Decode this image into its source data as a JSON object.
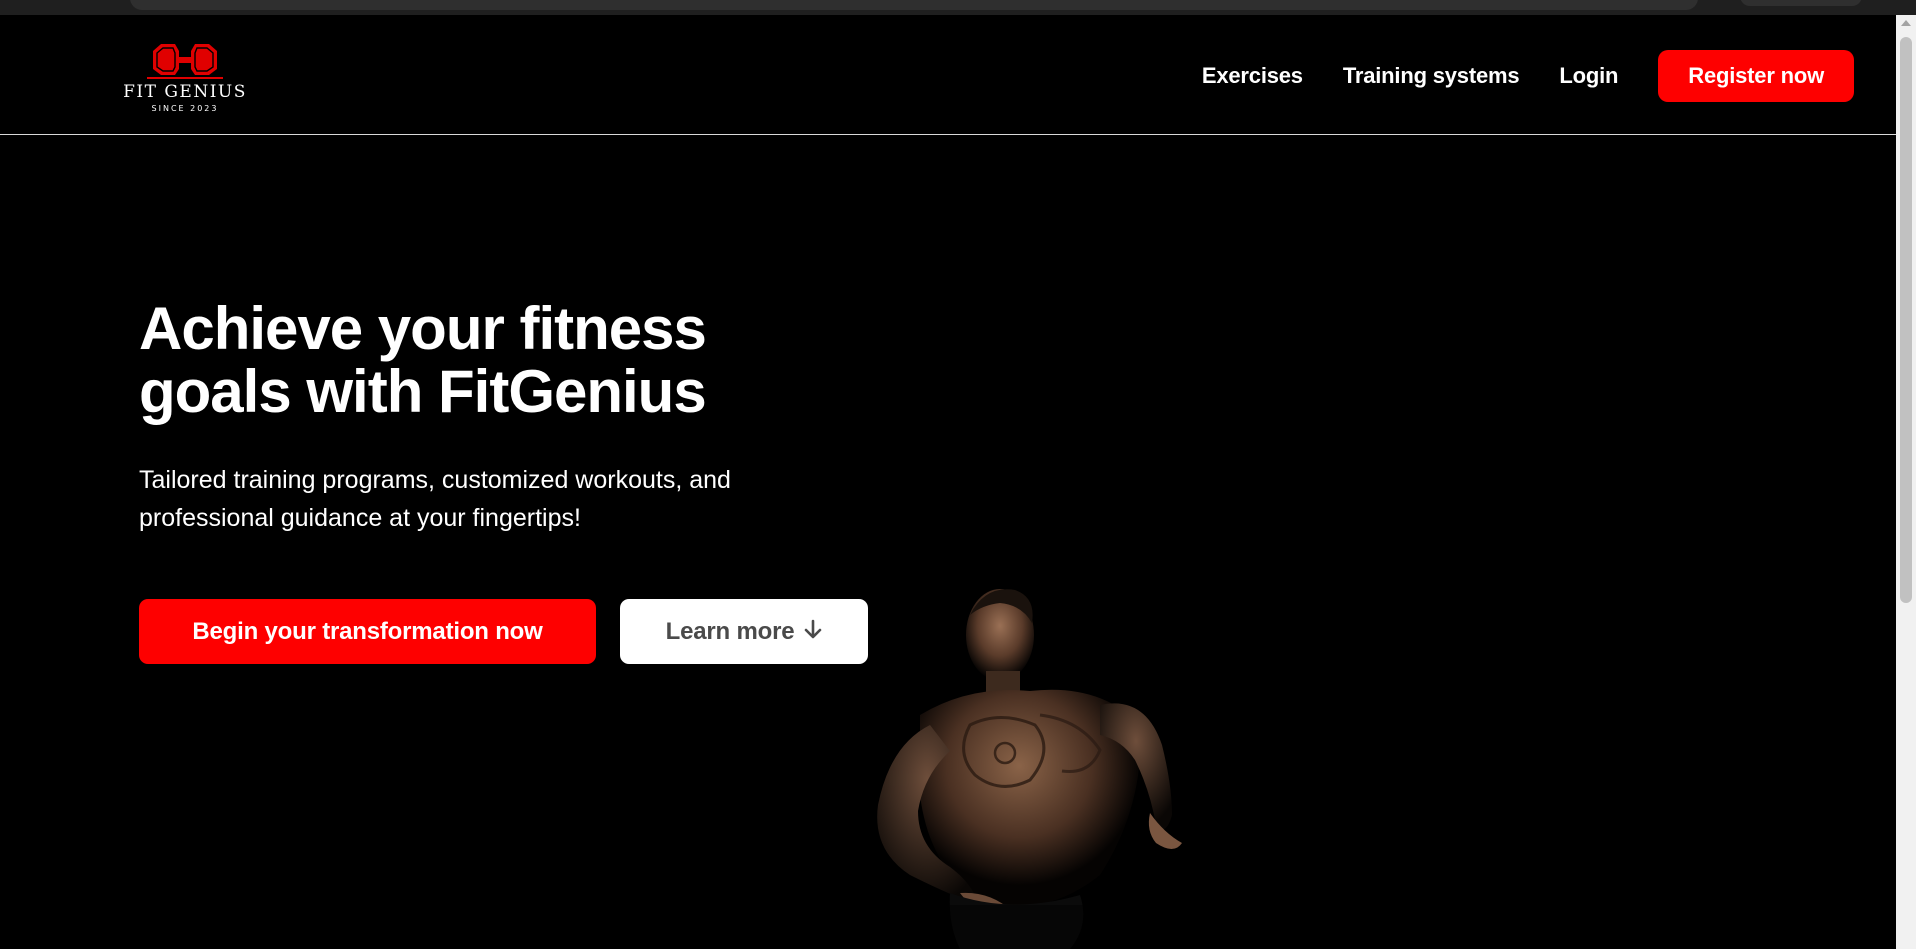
{
  "header": {
    "logo": {
      "name": "FIT GENIUS",
      "since": "SINCE 2023"
    },
    "nav": {
      "exercises": "Exercises",
      "training_systems": "Training systems",
      "login": "Login",
      "register": "Register now"
    }
  },
  "hero": {
    "title": "Achieve your fitness goals with FitGenius",
    "subtitle": "Tailored training programs, customized workouts, and professional guidance at your fingertips!",
    "cta_primary": "Begin your transformation now",
    "cta_secondary": "Learn more",
    "cta_secondary_icon": "arrow-down-icon"
  },
  "colors": {
    "accent": "#fe0000",
    "background": "#000000",
    "text": "#ffffff",
    "secondary_button_text": "#4a4a4a"
  }
}
